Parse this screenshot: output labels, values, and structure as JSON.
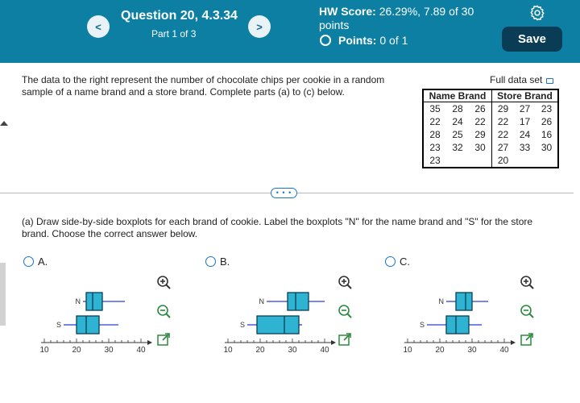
{
  "header": {
    "prev_label": "<",
    "next_label": ">",
    "question_title": "Question 20, 4.3.34",
    "part": "Part 1 of 3",
    "hw_score_label": "HW Score:",
    "hw_score_value": "26.29%, 7.89 of 30 points",
    "points_label": "Points:",
    "points_value": "0 of 1",
    "save_label": "Save",
    "settings_icon": "gear-icon"
  },
  "question": {
    "text": "The data to the right represent the number of chocolate chips per cookie in a random sample of a name brand and a store brand. Complete parts (a) to (c) below.",
    "full_data_label": "Full data set"
  },
  "table": {
    "headers": [
      "Name Brand",
      "Store Brand"
    ],
    "name_brand": [
      [
        "35",
        "28",
        "26"
      ],
      [
        "22",
        "24",
        "22"
      ],
      [
        "28",
        "25",
        "29"
      ],
      [
        "23",
        "32",
        "30"
      ],
      [
        "23",
        "",
        ""
      ]
    ],
    "store_brand": [
      [
        "29",
        "27",
        "23"
      ],
      [
        "22",
        "17",
        "26"
      ],
      [
        "22",
        "24",
        "16"
      ],
      [
        "27",
        "33",
        "30"
      ],
      [
        "20",
        "",
        ""
      ]
    ]
  },
  "more_label": "• • •",
  "part_a": {
    "text": "(a) Draw side-by-side boxplots for each brand of cookie. Label the boxplots \"N\" for the name brand and \"S\" for the store brand. Choose the correct answer below."
  },
  "options": [
    {
      "label": "A.",
      "axis_ticks": [
        "10",
        "20",
        "30",
        "40"
      ],
      "N": {
        "min": 22,
        "q1": 23,
        "median": 25,
        "q3": 28,
        "max": 35
      },
      "S": {
        "min": 16,
        "q1": 20,
        "median": 23,
        "q3": 27,
        "max": 33
      }
    },
    {
      "label": "B.",
      "axis_ticks": [
        "10",
        "20",
        "30",
        "40"
      ],
      "N": {
        "min": 22,
        "q1": 28.5,
        "median": 31,
        "q3": 35,
        "max": 40
      },
      "S": {
        "min": 16,
        "q1": 19,
        "median": 27.5,
        "q3": 32,
        "max": 33
      }
    },
    {
      "label": "C.",
      "axis_ticks": [
        "10",
        "20",
        "30",
        "40"
      ],
      "N": {
        "min": 22,
        "q1": 25,
        "median": 28,
        "q3": 30,
        "max": 35
      },
      "S": {
        "min": 16,
        "q1": 22,
        "median": 25,
        "q3": 29,
        "max": 33
      }
    }
  ],
  "box_labels": {
    "N": "N",
    "S": "S"
  },
  "colors": {
    "header": "#0c7fa3",
    "box_fill": "#2fb3d3",
    "box_stroke": "#0b3f55",
    "whisker": "#2b3fd9",
    "link": "#1a73c9"
  }
}
